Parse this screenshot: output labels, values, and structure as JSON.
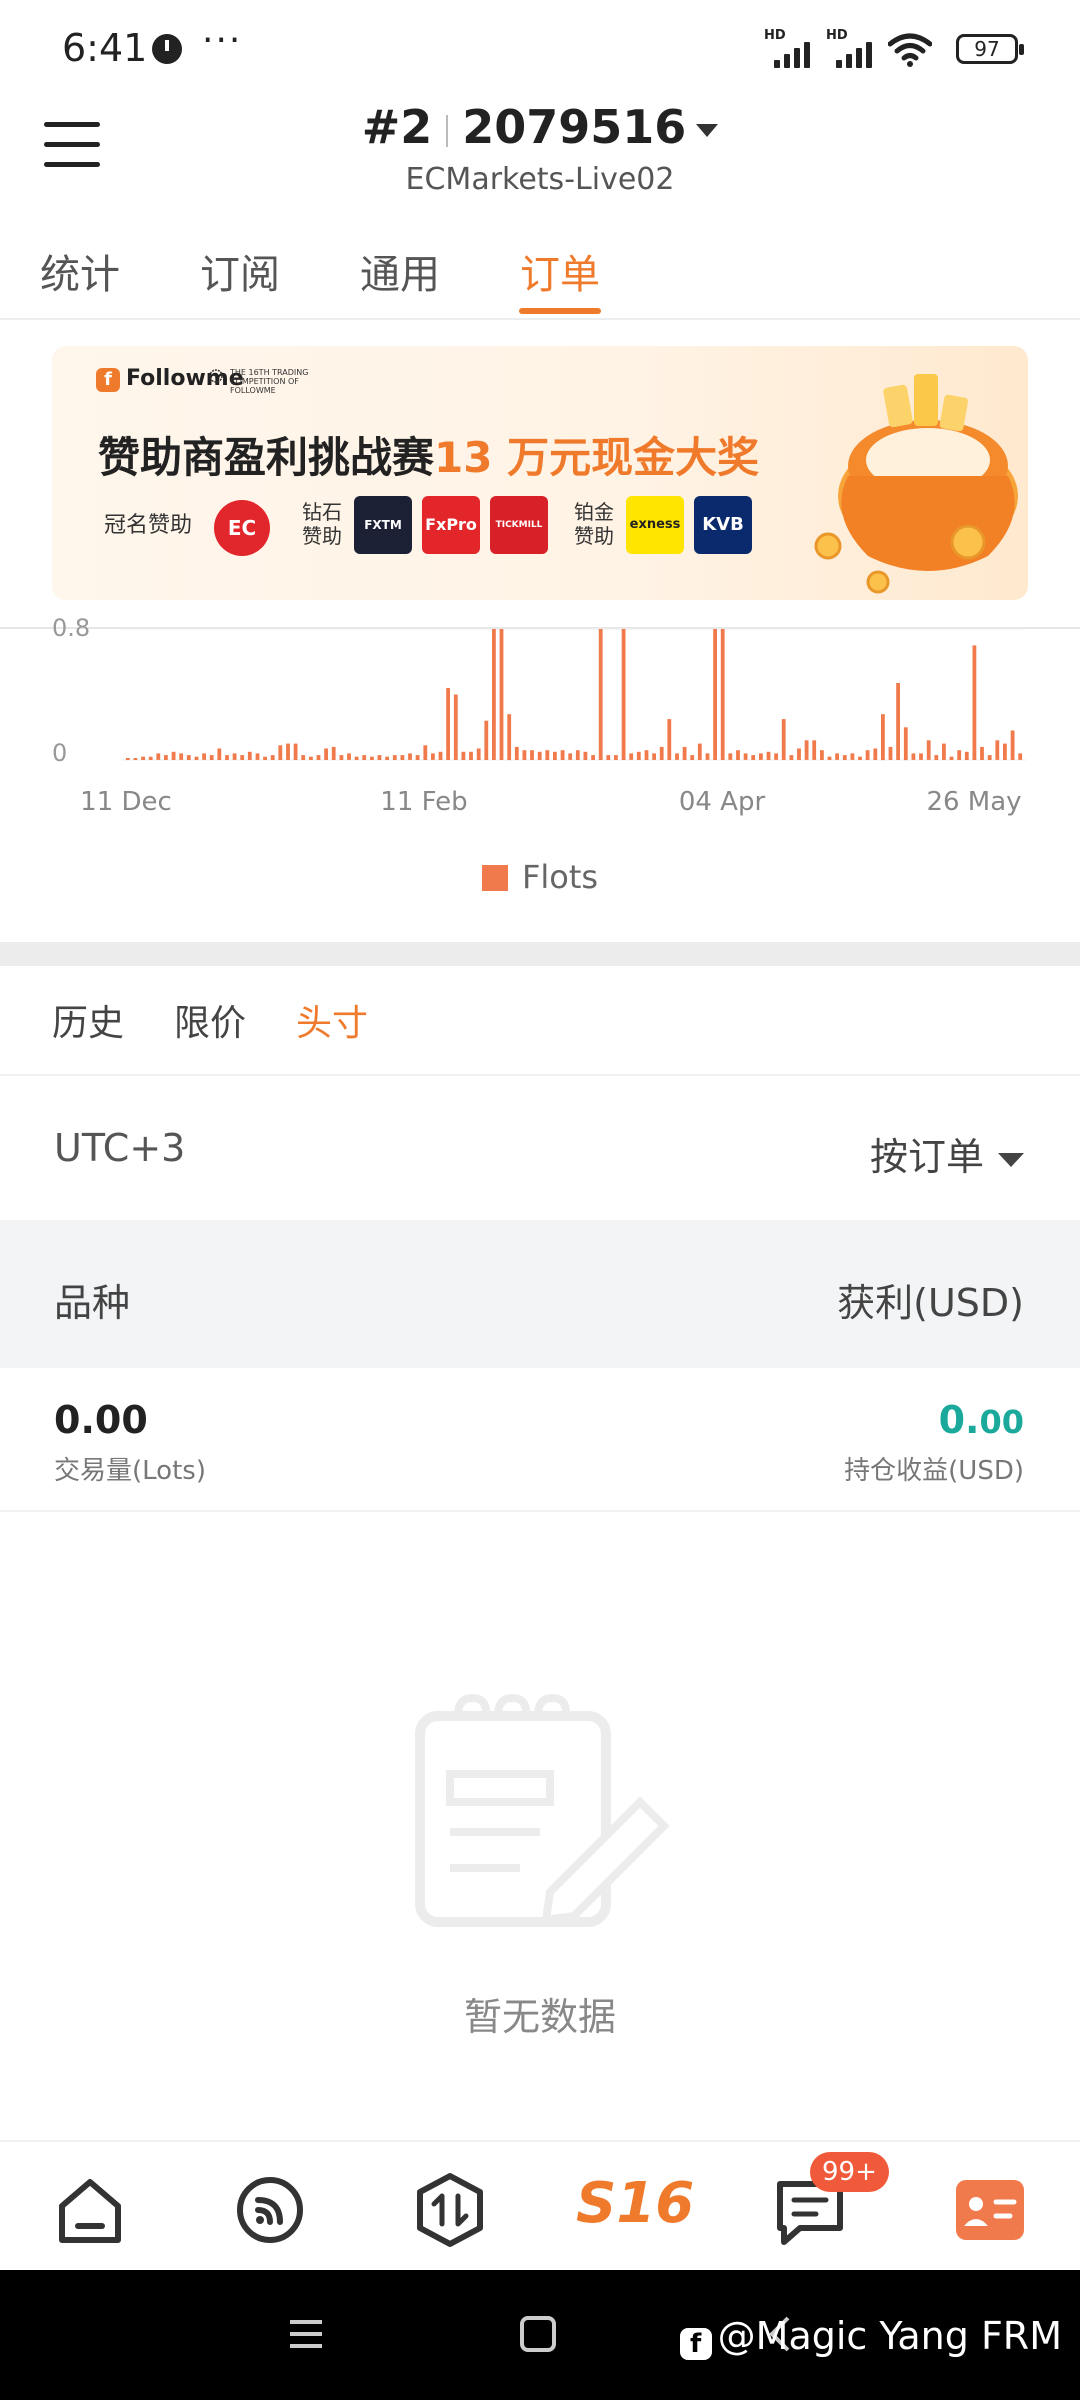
{
  "status_bar": {
    "time": "6:41",
    "more": "···",
    "signal_1": "HD",
    "signal_2": "HD",
    "battery": "97"
  },
  "header": {
    "rank": "#2",
    "account": "2079516",
    "server": "ECMarkets-Live02"
  },
  "tabs": [
    {
      "label": "统计"
    },
    {
      "label": "订阅"
    },
    {
      "label": "通用"
    },
    {
      "label": "订单"
    }
  ],
  "banner": {
    "brand": "Followme",
    "competition_badge": "THE 16TH TRADING COMPETITION OF FOLLOWME",
    "title_main": "赞助商盈利挑战赛",
    "title_highlight": "13 万元现金大奖",
    "title_sponsor": "冠名赞助",
    "diamond_label": "钻石赞助",
    "platinum_label": "铂金赞助",
    "title_sponsor_logo": "EC",
    "diamond_sponsors": [
      "FXTM",
      "FxPro",
      "TICKMILL"
    ],
    "platinum_sponsors": [
      "exness",
      "KVB"
    ]
  },
  "chart_data": {
    "type": "bar",
    "y_ticks": [
      "0",
      "0.8"
    ],
    "ylim": [
      0,
      0.8
    ],
    "x_ticks": [
      "11 Dec",
      "11 Feb",
      "04 Apr",
      "26 May"
    ],
    "values": [
      0.01,
      0.01,
      0.02,
      0.02,
      0.04,
      0.03,
      0.05,
      0.04,
      0.03,
      0.02,
      0.04,
      0.03,
      0.07,
      0.03,
      0.04,
      0.03,
      0.05,
      0.04,
      0.02,
      0.03,
      0.09,
      0.1,
      0.1,
      0.03,
      0.02,
      0.03,
      0.07,
      0.08,
      0.03,
      0.04,
      0.02,
      0.03,
      0.02,
      0.03,
      0.02,
      0.03,
      0.03,
      0.04,
      0.03,
      0.09,
      0.04,
      0.05,
      0.44,
      0.4,
      0.05,
      0.05,
      0.07,
      0.24,
      0.8,
      0.8,
      0.28,
      0.08,
      0.06,
      0.06,
      0.05,
      0.06,
      0.05,
      0.06,
      0.04,
      0.06,
      0.05,
      0.03,
      0.8,
      0.03,
      0.03,
      0.8,
      0.04,
      0.05,
      0.06,
      0.04,
      0.08,
      0.25,
      0.04,
      0.08,
      0.03,
      0.1,
      0.04,
      0.8,
      0.8,
      0.04,
      0.06,
      0.04,
      0.03,
      0.04,
      0.05,
      0.04,
      0.25,
      0.03,
      0.07,
      0.12,
      0.12,
      0.06,
      0.02,
      0.04,
      0.03,
      0.04,
      0.02,
      0.06,
      0.07,
      0.28,
      0.08,
      0.47,
      0.2,
      0.04,
      0.04,
      0.12,
      0.03,
      0.1,
      0.02,
      0.06,
      0.05,
      0.7,
      0.08,
      0.03,
      0.12,
      0.1,
      0.18,
      0.04
    ],
    "legend": [
      {
        "name": "Flots",
        "color": "#f07a4b"
      }
    ],
    "bar_color": "#f07a4b"
  },
  "order_tabs": [
    {
      "label": "历史"
    },
    {
      "label": "限价"
    },
    {
      "label": "头寸"
    }
  ],
  "filter": {
    "timezone": "UTC+3",
    "sort": "按订单"
  },
  "table_header": {
    "symbol": "品种",
    "profit": "获利(USD)"
  },
  "summary": {
    "volume": "0.00",
    "volume_label": "交易量(Lots)",
    "pnl_int": "0.",
    "pnl_dec": "00",
    "pnl_label": "持仓收益(USD)"
  },
  "empty": {
    "text": "暂无数据"
  },
  "bottom_nav": {
    "s16": "S16",
    "badge": "99+"
  },
  "watermark": {
    "text": "@Magic Yang FRM"
  },
  "colors": {
    "accent": "#f07a2b",
    "profit": "#1aa99a"
  }
}
